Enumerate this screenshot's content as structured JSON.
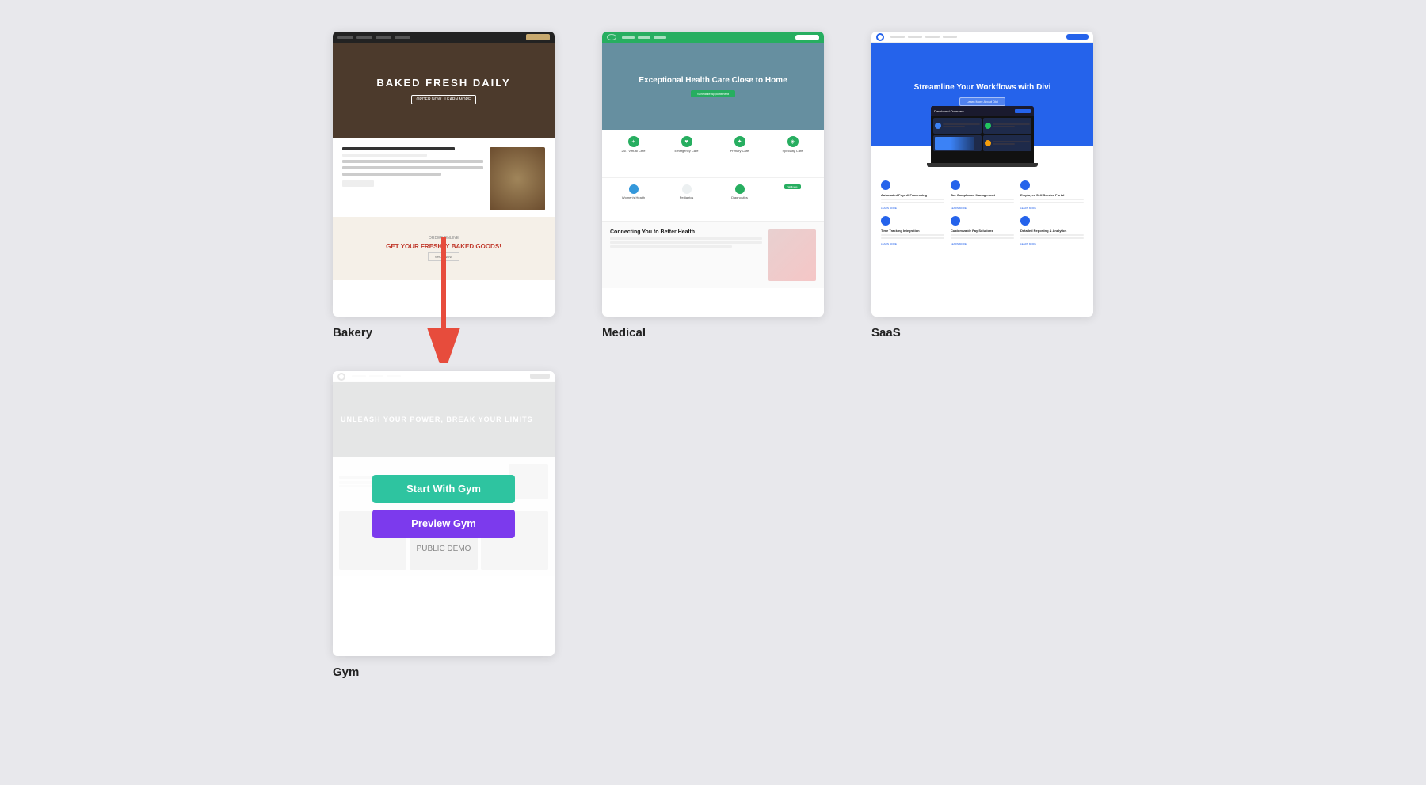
{
  "templates": [
    {
      "id": "bakery",
      "label": "Bakery",
      "hero_title": "BAKED FRESH\nDAILY",
      "promo_label": "ORDER ONLINE",
      "promo_title": "GET YOUR FRESHLY\nBAKED GOODS!"
    },
    {
      "id": "medical",
      "label": "Medical",
      "hero_title": "Exceptional Health\nCare Close to Home",
      "connect_title": "Connecting You to Better Health",
      "icons": [
        "24/7 Virtual Care",
        "Emergency Care",
        "Primary Care",
        "Specialty Care"
      ],
      "icons2": [
        "Women's Health",
        "Pediatrics",
        "Diagnostics",
        ""
      ]
    },
    {
      "id": "saas",
      "label": "SaaS",
      "hero_title": "Streamline Your\nWorkflows with Divi",
      "screen_header": "Dashboard Overview",
      "features": [
        {
          "title": "Automated Payroll Processing"
        },
        {
          "title": "Tax Compliance Management"
        },
        {
          "title": "Employee Self-Service Portal"
        },
        {
          "title": "Time Tracking Integration"
        },
        {
          "title": "Customizable Pay Solutions"
        },
        {
          "title": "Detailed Reporting & Analytics"
        }
      ]
    },
    {
      "id": "gym",
      "label": "Gym",
      "hero_title": "UNLEASH YOUR\nPOWER, BREAK\nYOUR LIMITS",
      "start_btn_label": "Start With Gym",
      "preview_btn_label": "Preview Gym",
      "public_label": "PUBLIC DEMO"
    }
  ],
  "colors": {
    "bakery_btn": "#333",
    "medical_green": "#27ae60",
    "saas_blue": "#2563eb",
    "gym_teal": "#2ec4a0",
    "gym_purple": "#7c3aed"
  }
}
